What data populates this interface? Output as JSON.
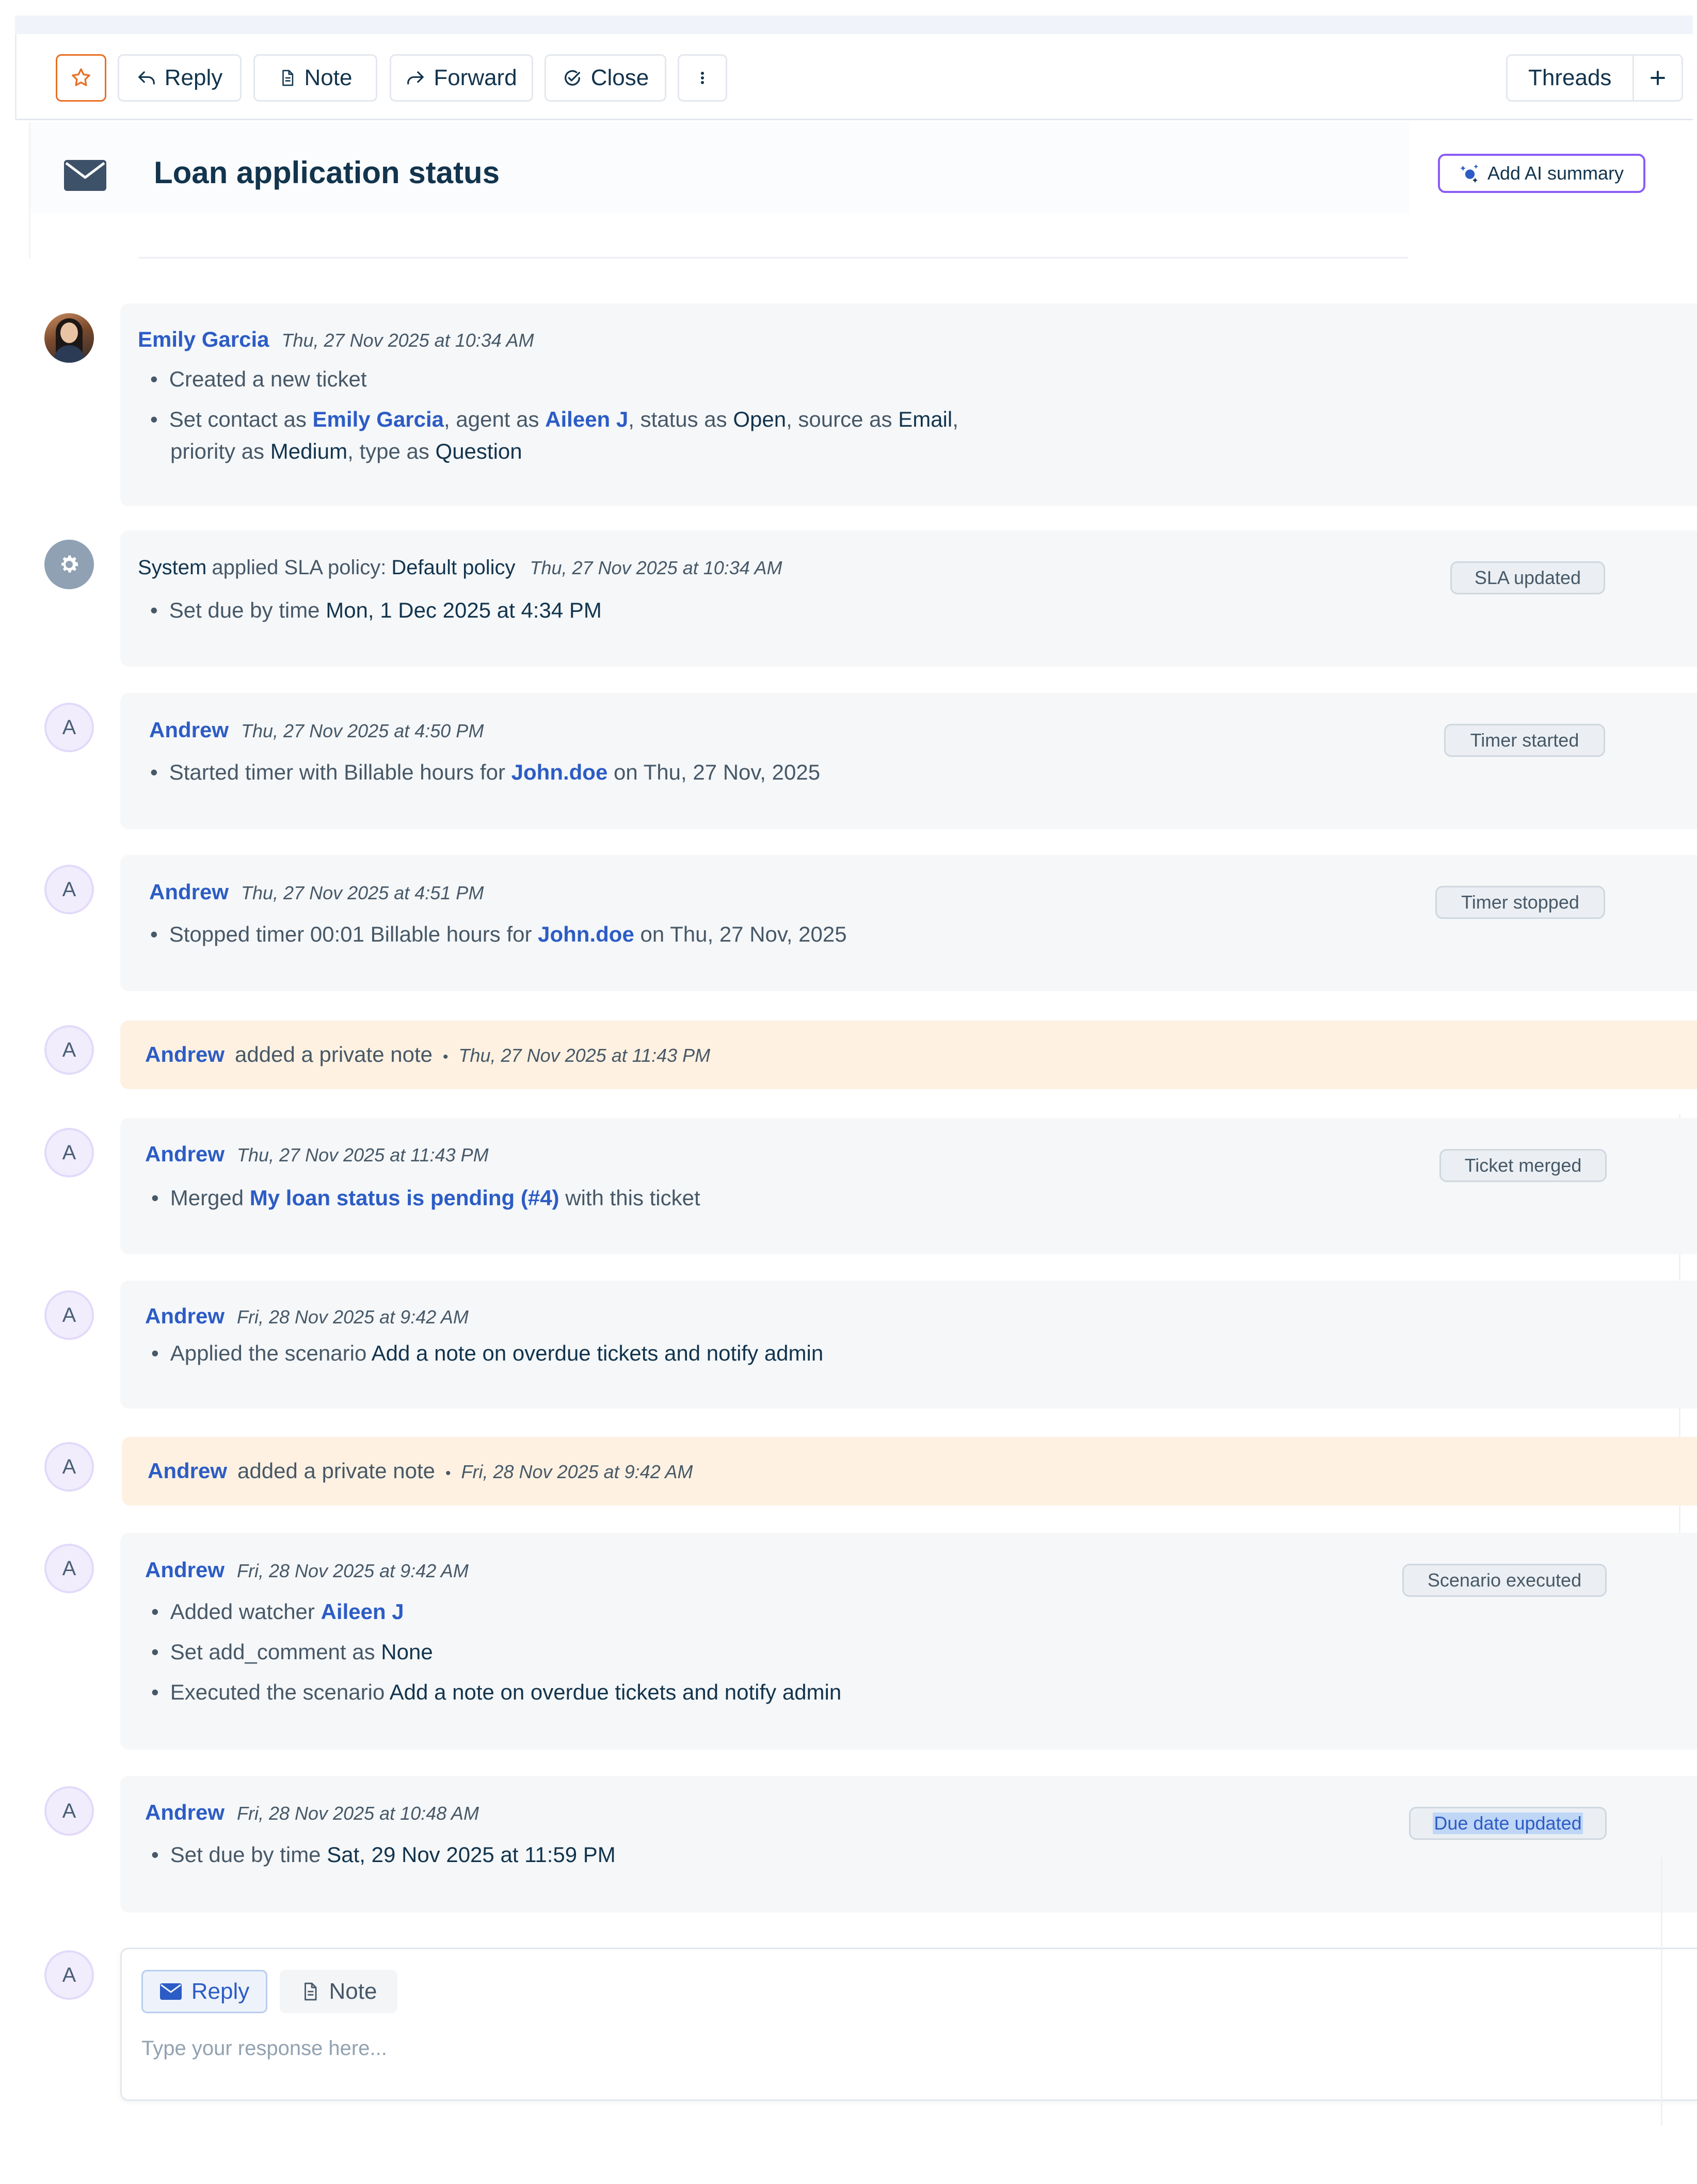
{
  "toolbar": {
    "star_icon": "star-icon",
    "reply_label": "Reply",
    "note_label": "Note",
    "forward_label": "Forward",
    "close_label": "Close",
    "more_icon": "vertical-dots-icon",
    "threads_label": "Threads",
    "add_icon": "plus-icon"
  },
  "ticket": {
    "title": "Loan application status",
    "ai_summary_label": "Add AI summary"
  },
  "colors": {
    "accent": "#2c5cc5",
    "star": "#e86f25",
    "note_bg": "#fef1e1",
    "card_bg": "#f5f7f9",
    "ai_border": "#8b5cf6"
  },
  "activities": [
    {
      "author": "Emily Garcia",
      "timestamp": "Thu, 27 Nov 2025 at 10:34 AM",
      "bullet1": "Created a new ticket",
      "b2": {
        "p1": "Set contact as ",
        "contact": "Emily Garcia",
        "p2": ", agent as ",
        "agent": "Aileen J",
        "p3": ", status as ",
        "status": "Open",
        "p4": ", source as ",
        "source": "Email",
        "p5": ",",
        "p6": "priority as ",
        "priority": "Medium",
        "p7": ", type as ",
        "type": "Question"
      }
    },
    {
      "author": "System",
      "action": "applied SLA policy:",
      "policy": "Default policy",
      "timestamp": "Thu, 27 Nov 2025 at 10:34 AM",
      "badge": "SLA updated",
      "bullet_prefix": "Set due by time ",
      "bullet_value": "Mon, 1 Dec 2025 at 4:34 PM"
    },
    {
      "author": "Andrew",
      "timestamp": "Thu, 27 Nov 2025 at 4:50 PM",
      "badge": "Timer started",
      "p1": "Started timer with Billable hours for ",
      "link": "John.doe",
      "p2": " on Thu, 27 Nov, 2025"
    },
    {
      "author": "Andrew",
      "timestamp": "Thu, 27 Nov 2025 at 4:51 PM",
      "badge": "Timer stopped",
      "p1": "Stopped timer 00:01 Billable hours for ",
      "link": "John.doe",
      "p2": " on Thu, 27 Nov, 2025"
    },
    {
      "author": "Andrew",
      "action": "added a private note",
      "separator": "•",
      "timestamp": "Thu, 27 Nov 2025 at 11:43 PM"
    },
    {
      "author": "Andrew",
      "timestamp": "Thu, 27 Nov 2025 at 11:43 PM",
      "badge": "Ticket merged",
      "p1": "Merged ",
      "link": "My loan status is pending (#4)",
      "p2": " with this ticket"
    },
    {
      "author": "Andrew",
      "timestamp": "Fri, 28 Nov 2025 at 9:42 AM",
      "p1": "Applied the scenario ",
      "value": "Add a note on overdue tickets and notify admin"
    },
    {
      "author": "Andrew",
      "action": "added a private note",
      "separator": "•",
      "timestamp": "Fri, 28 Nov 2025 at 9:42 AM"
    },
    {
      "author": "Andrew",
      "timestamp": "Fri, 28 Nov 2025 at 9:42 AM",
      "badge": "Scenario executed",
      "b1_prefix": "Added watcher ",
      "b1_link": "Aileen J",
      "b2_prefix": "Set add_comment as ",
      "b2_value": "None",
      "b3_prefix": "Executed the scenario ",
      "b3_value": "Add a note on overdue tickets and notify admin"
    },
    {
      "author": "Andrew",
      "timestamp": "Fri, 28 Nov 2025 at 10:48 AM",
      "badge": "Due date updated",
      "bullet_prefix": "Set due by time ",
      "bullet_value": "Sat, 29 Nov 2025 at 11:59 PM"
    }
  ],
  "avatar_initial": "A",
  "composer": {
    "reply_label": "Reply",
    "note_label": "Note",
    "placeholder": "Type your response here..."
  }
}
